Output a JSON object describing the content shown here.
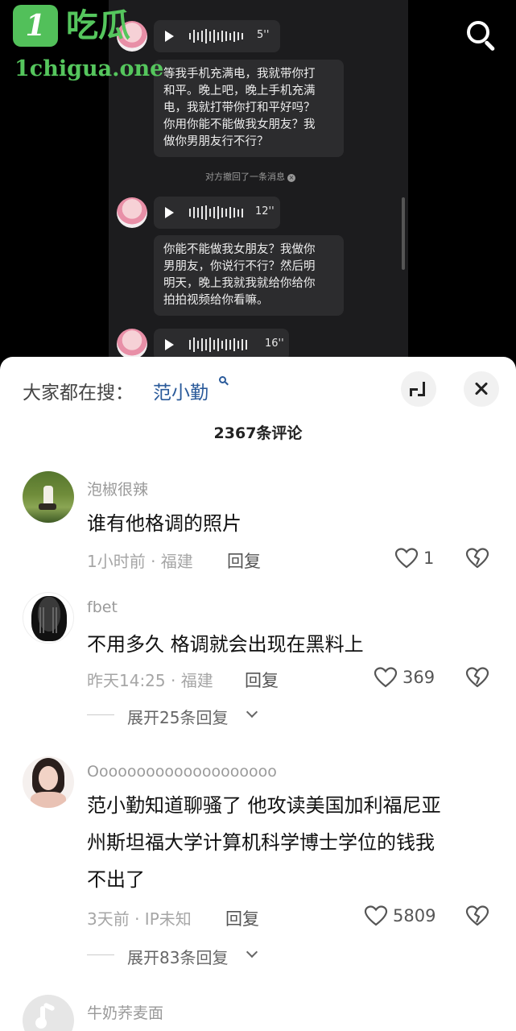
{
  "watermark": {
    "badge": "1",
    "name": "吃瓜",
    "url": "1chigua.one"
  },
  "chat": {
    "voices": [
      {
        "duration": "5''"
      },
      {
        "duration": "12''"
      },
      {
        "duration": "16''"
      }
    ],
    "bubbles": [
      [
        "等我手机充满电，我就带你打",
        "和平。晚上吧，晚上手机充满",
        "电，我就打带你打和平好吗？",
        "你用你能不能做我女朋友？我",
        "做你男朋友行不行？"
      ],
      [
        "你能不能做我女朋友？我做你",
        "男朋友，你说行不行？然后明",
        "明天，晚上我就我就给你给你",
        "拍拍视频给你看嘛。"
      ]
    ],
    "recall_notice": "对方撤回了一条消息"
  },
  "sheet": {
    "trending_label": "大家都在搜：",
    "trending_keyword": "范小勤",
    "comment_count": "2367条评论"
  },
  "comments": [
    {
      "user": "泡椒很辣",
      "lines": [
        "谁有他格调的照片"
      ],
      "time_location": "1小时前 · 福建",
      "reply_label": "回复",
      "likes": "1"
    },
    {
      "user": "fbet",
      "lines": [
        "不用多久 格调就会出现在黑料上"
      ],
      "time_location": "昨天14:25 · 福建",
      "reply_label": "回复",
      "likes": "369",
      "expand": "展开25条回复"
    },
    {
      "user": "Oooooooooooooooooooo",
      "lines": [
        "范小勤知道聊骚了  他攻读美国加利福尼亚",
        "州斯坦福大学计算机科学博士学位的钱我",
        "不出了"
      ],
      "time_location": "3天前 · IP未知",
      "reply_label": "回复",
      "likes": "5809",
      "expand": "展开83条回复"
    },
    {
      "user": "牛奶荞麦面"
    }
  ],
  "colors": {
    "accent_link": "#2a5a9a",
    "watermark_green": "#52c05a",
    "chat_bg": "#1c1c1e"
  },
  "icons": [
    "play-icon",
    "search-icon",
    "expand-icon",
    "close-icon",
    "heart-icon",
    "dislike-heart-icon",
    "chevron-down-icon"
  ]
}
